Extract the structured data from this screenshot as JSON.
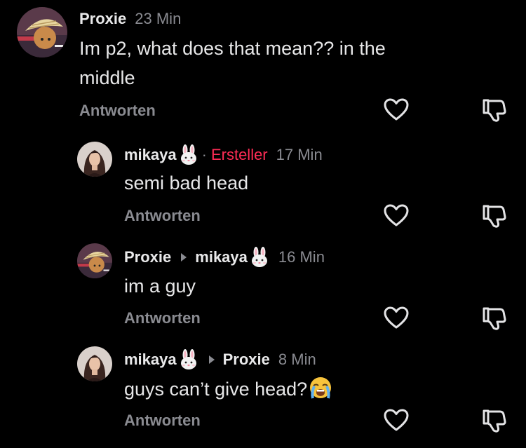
{
  "comments": [
    {
      "username": "Proxie",
      "time": "23 Min",
      "text": "Im p2, what does that mean?? in the middle",
      "reply_label": "Antworten"
    },
    {
      "username": "mikaya",
      "creator_label": "Ersteller",
      "time": "17 Min",
      "text": "semi bad head",
      "reply_label": "Antworten"
    },
    {
      "username": "Proxie",
      "reply_to": "mikaya",
      "time": "16 Min",
      "text": "im a guy",
      "reply_label": "Antworten"
    },
    {
      "username": "mikaya",
      "reply_to": "Proxie",
      "time": "8 Min",
      "text": "guys can’t give head?",
      "reply_label": "Antworten"
    }
  ],
  "icons": {
    "bunny": "rabbit-face-emoji",
    "crying": "loudly-crying-face-emoji",
    "like": "heart-outline-icon",
    "dislike": "thumbs-down-outline-icon"
  },
  "colors": {
    "background": "#000000",
    "username": "#e9e9ea",
    "secondary": "#8a8b91",
    "creator": "#fe2c55"
  }
}
